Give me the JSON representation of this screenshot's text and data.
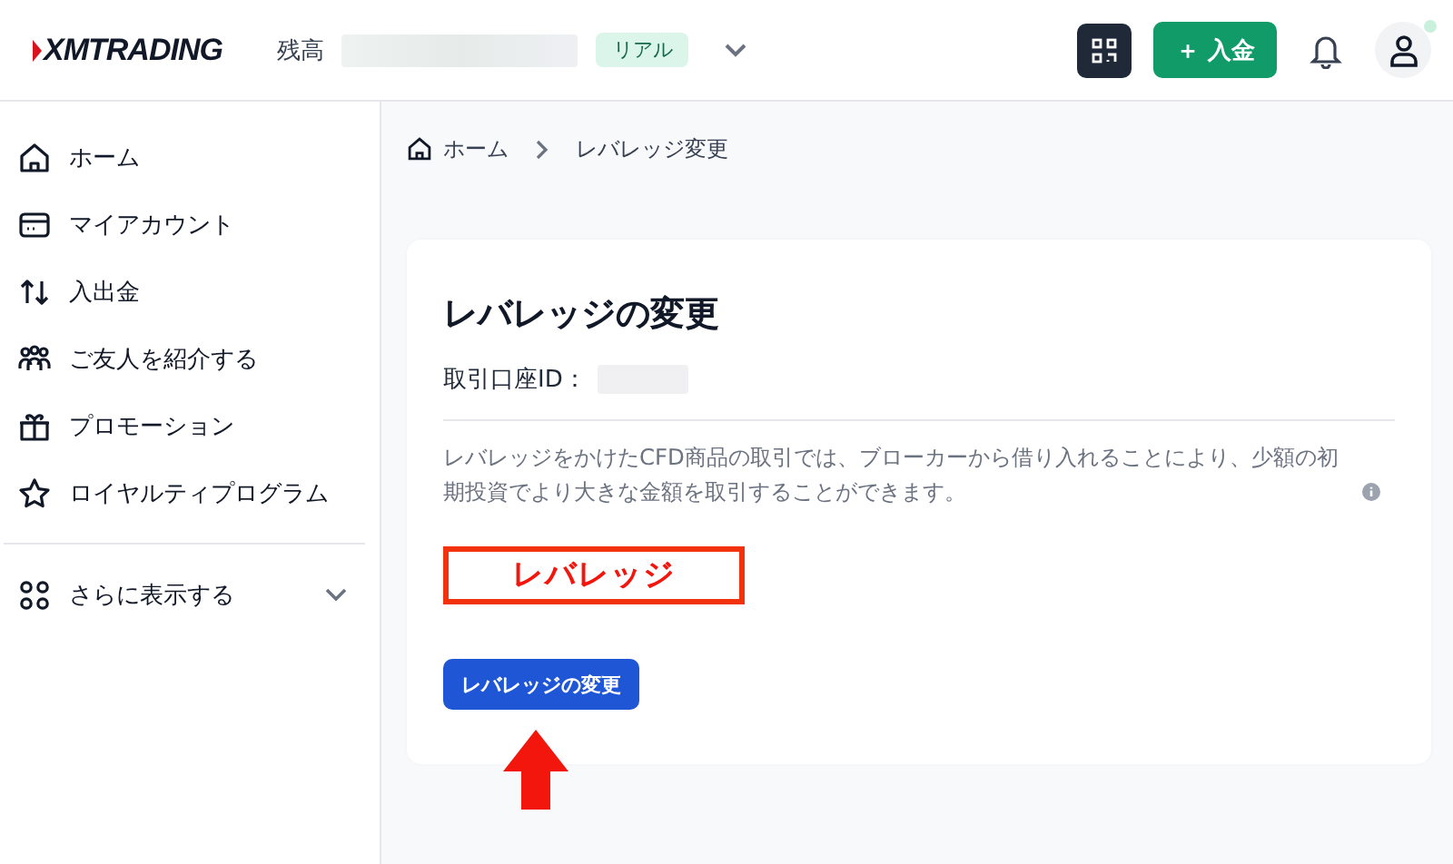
{
  "header": {
    "logo": "XMTRADING",
    "balance_label": "残高",
    "account_badge": "リアル",
    "deposit_button": "＋ 入金",
    "notification_dot": true
  },
  "sidebar": {
    "items": [
      {
        "label": "ホーム"
      },
      {
        "label": "マイアカウント"
      },
      {
        "label": "入出金"
      },
      {
        "label": "ご友人を紹介する"
      },
      {
        "label": "プロモーション"
      },
      {
        "label": "ロイヤルティプログラム"
      }
    ],
    "more": {
      "label": "さらに表示する",
      "expanded": false
    }
  },
  "breadcrumb": [
    {
      "label": "ホーム"
    },
    {
      "label": "レバレッジ変更"
    }
  ],
  "card": {
    "title": "レバレッジの変更",
    "account_id_label": "取引口座ID：",
    "description": "レバレッジをかけたCFD商品の取引では、ブローカーから借り入れることにより、少額の初期投資でより大きな金額を取引することができます。",
    "annotation": "レバレッジ",
    "button": "レバレッジの変更"
  }
}
